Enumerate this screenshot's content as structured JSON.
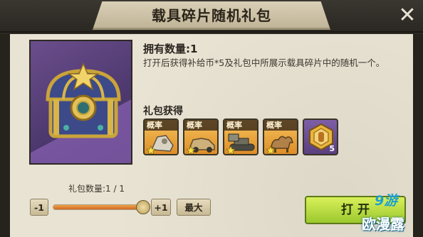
{
  "dialog": {
    "title": "载具碎片随机礼包",
    "close_icon": "close-icon"
  },
  "item": {
    "owned_label": "拥有数量:1",
    "description": "打开后获得补给币*5及礼包中所展示载具碎片中的随机一个。",
    "icon": "treasure-chest-icon"
  },
  "rewards": {
    "title": "礼包获得",
    "slots": [
      {
        "tag": "概率",
        "icon": "vehicle-fragment-icon"
      },
      {
        "tag": "概率",
        "icon": "car-fragment-icon"
      },
      {
        "tag": "概率",
        "icon": "tank-fragment-icon"
      },
      {
        "tag": "概率",
        "icon": "camel-fragment-icon"
      },
      {
        "tag": "",
        "icon": "supply-coin-icon",
        "count": "5"
      }
    ]
  },
  "controls": {
    "quantity_label": "礼包数量:1 / 1",
    "minus_label": "-1",
    "plus_label": "+1",
    "max_label": "最大",
    "open_label": "打 开",
    "slider_value": 1.0
  },
  "watermark": {
    "logo": "9游",
    "text": "欧漫露"
  },
  "colors": {
    "accent_open": "#b4dc3c",
    "slot_orange": "#f0ad45",
    "slot_purple": "#6f519a",
    "title_banner": "#d2c7ab"
  }
}
